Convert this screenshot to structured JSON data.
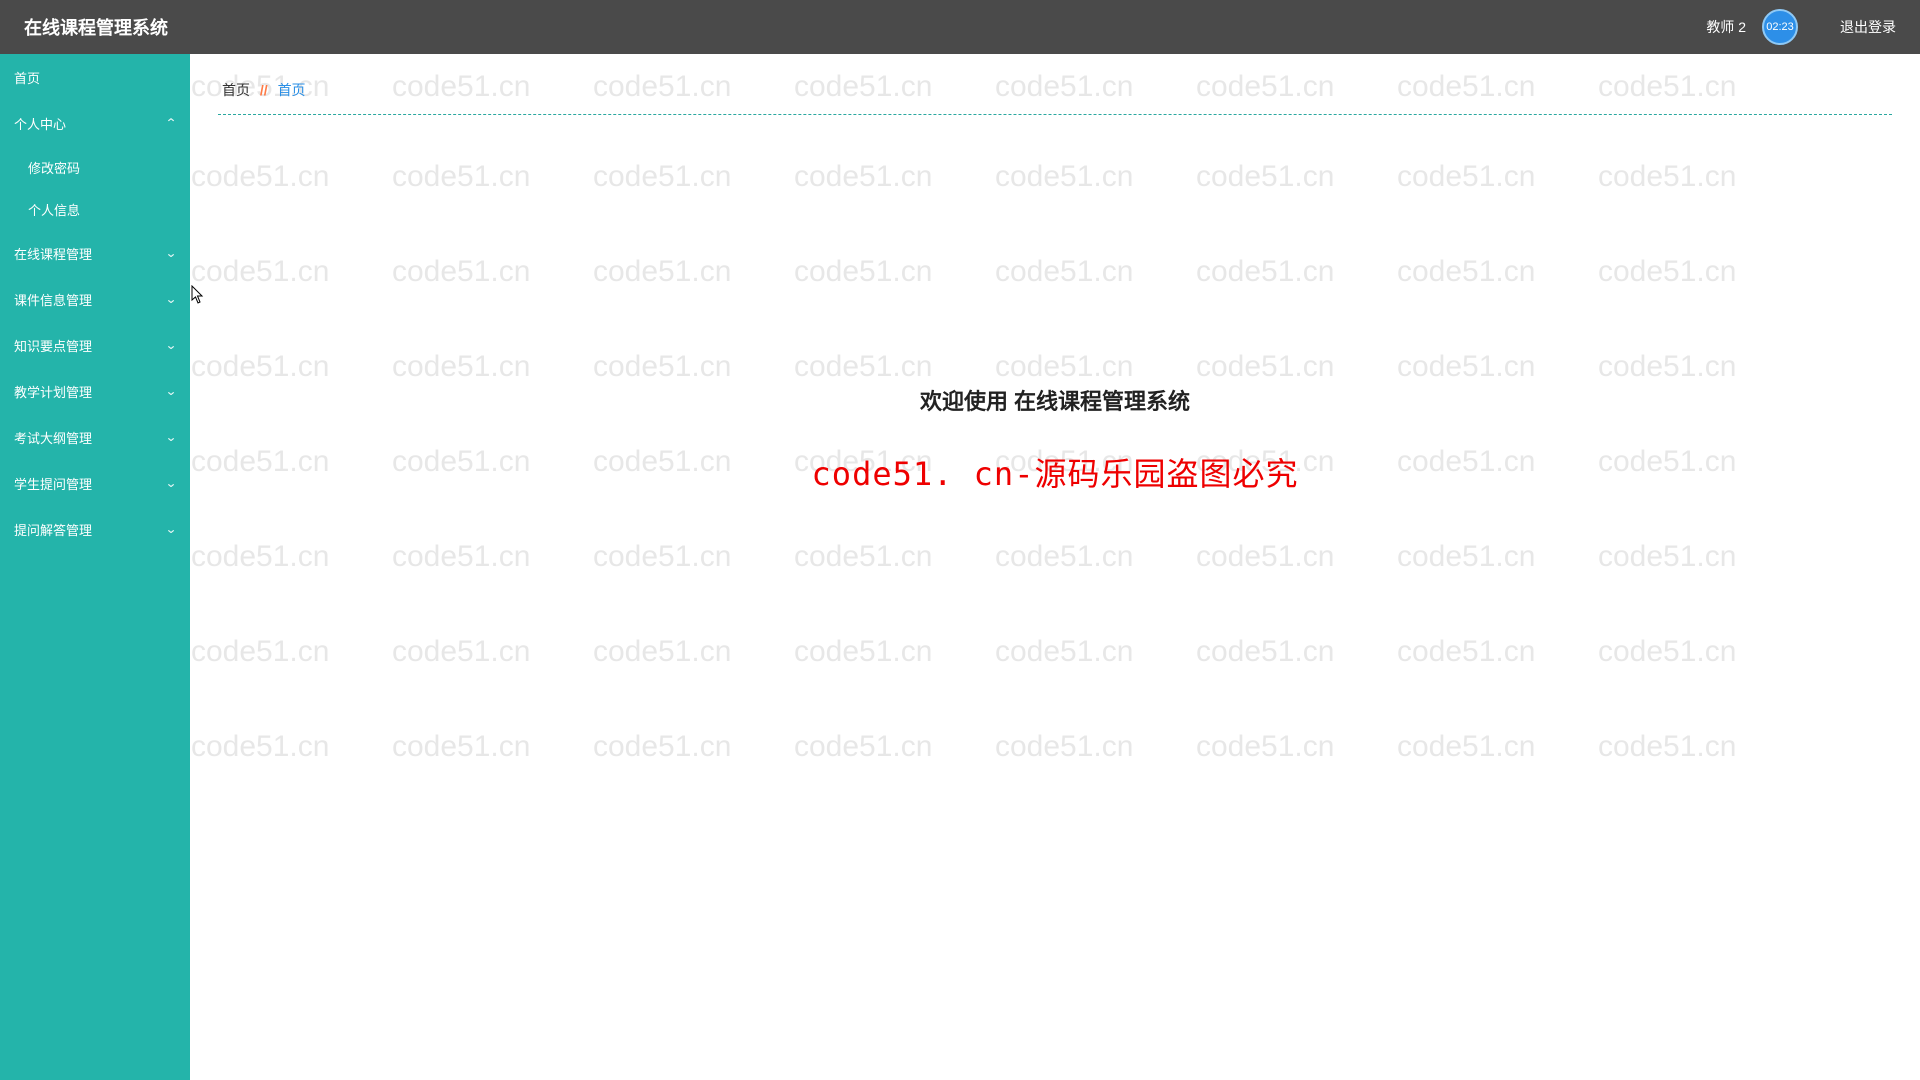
{
  "header": {
    "title": "在线课程管理系统",
    "user": "教师 2",
    "logout_partial": "退",
    "logout": "退出登录",
    "time": "02:23"
  },
  "sidebar": {
    "home": "首页",
    "personal": "个人中心",
    "sub_pwd": "修改密码",
    "sub_info": "个人信息",
    "course": "在线课程管理",
    "material": "课件信息管理",
    "knowledge": "知识要点管理",
    "plan": "教学计划管理",
    "exam": "考试大纲管理",
    "qa": "学生提问管理",
    "answer": "提问解答管理"
  },
  "breadcrumb": {
    "root": "首页",
    "sep": "//",
    "current": "首页"
  },
  "main": {
    "welcome": "欢迎使用 在线课程管理系统",
    "watermark_notice": "code51. cn-源码乐园盗图必究"
  },
  "watermark": "code51.cn"
}
